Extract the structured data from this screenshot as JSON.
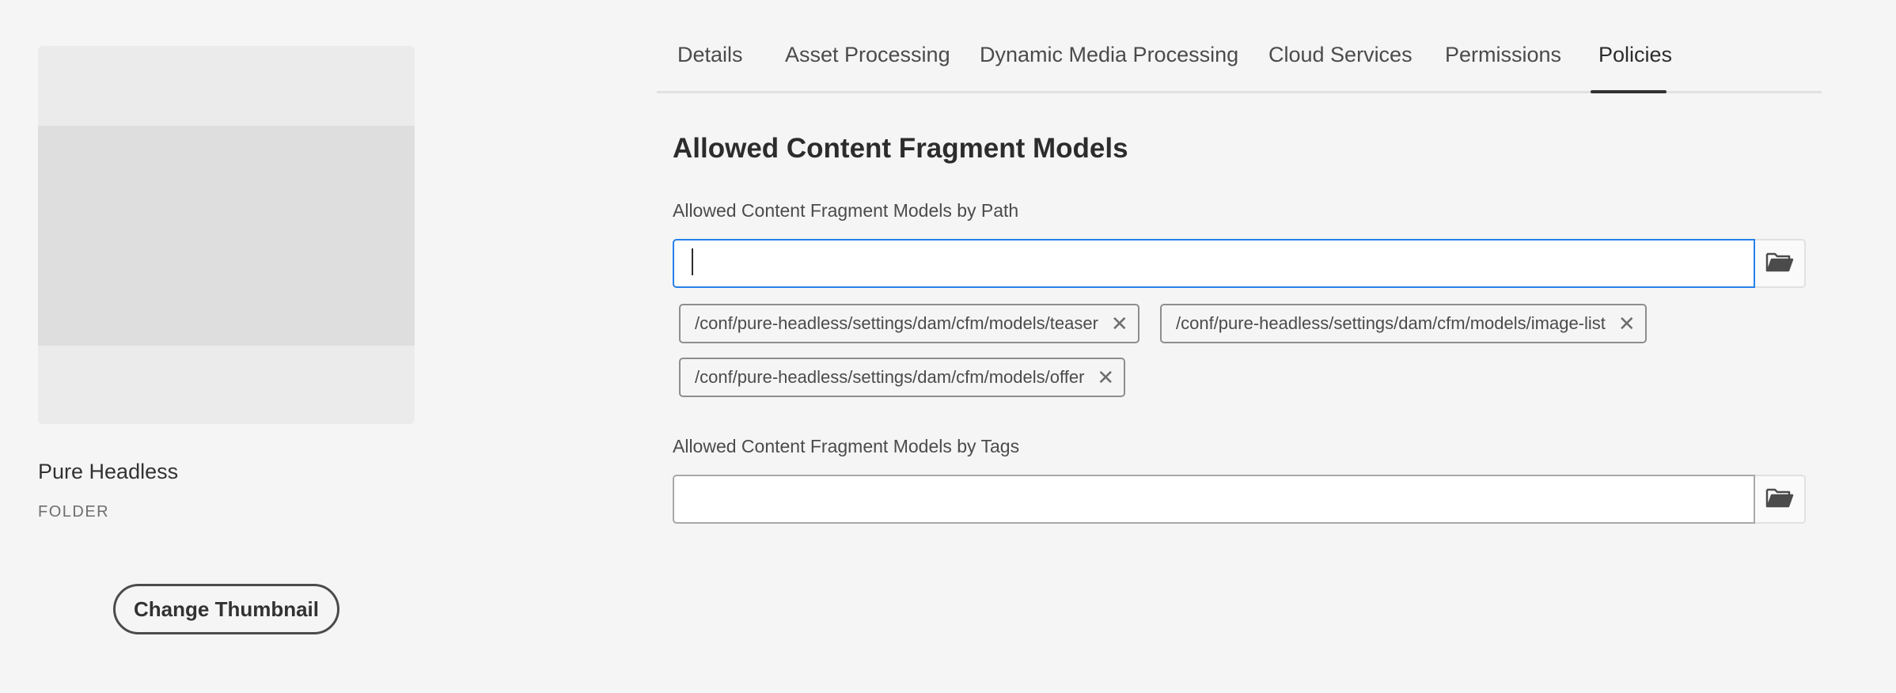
{
  "item": {
    "title": "Pure Headless",
    "type": "FOLDER",
    "change_thumbnail_label": "Change Thumbnail"
  },
  "tabs": [
    {
      "label": "Details",
      "active": false
    },
    {
      "label": "Asset Processing",
      "active": false
    },
    {
      "label": "Dynamic Media Processing",
      "active": false
    },
    {
      "label": "Cloud Services",
      "active": false
    },
    {
      "label": "Permissions",
      "active": false
    },
    {
      "label": "Policies",
      "active": true
    }
  ],
  "policies": {
    "heading": "Allowed Content Fragment Models",
    "by_path": {
      "label": "Allowed Content Fragment Models by Path",
      "value": "",
      "tags": [
        "/conf/pure-headless/settings/dam/cfm/models/teaser",
        "/conf/pure-headless/settings/dam/cfm/models/image-list",
        "/conf/pure-headless/settings/dam/cfm/models/offer"
      ]
    },
    "by_tags": {
      "label": "Allowed Content Fragment Models by Tags",
      "value": ""
    }
  },
  "icons": {
    "browse": "folder-open-icon",
    "remove": "close-icon"
  },
  "colors": {
    "background": "#f5f5f5",
    "focus": "#2680eb",
    "active_tab": "#323232"
  }
}
